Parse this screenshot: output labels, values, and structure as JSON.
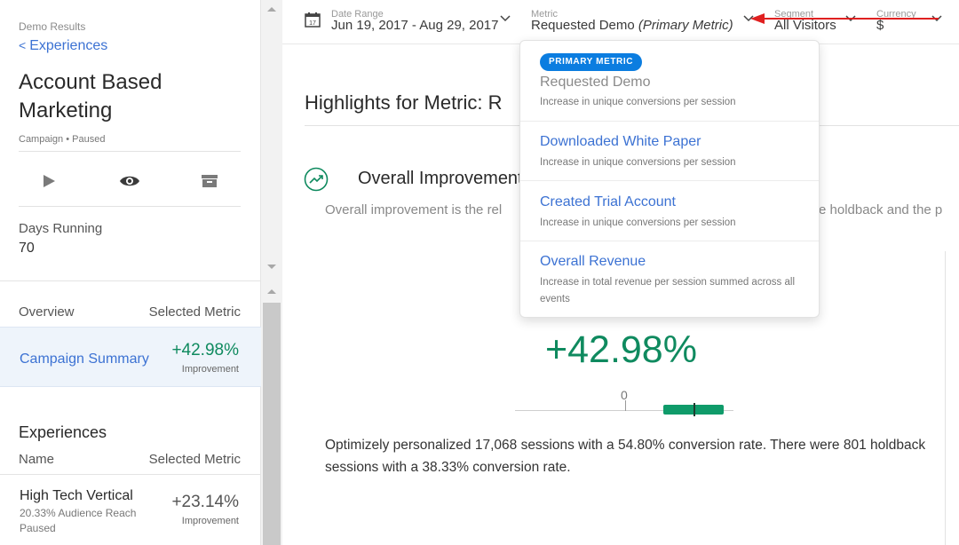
{
  "sidebar": {
    "breadcrumb_label": "Demo Results",
    "breadcrumb_link": "Experiences",
    "title": "Account Based Marketing",
    "meta_type": "Campaign",
    "meta_sep": "•",
    "meta_status": "Paused",
    "actions": [
      {
        "name": "play",
        "icon": "play-icon"
      },
      {
        "name": "preview",
        "icon": "eye-icon"
      },
      {
        "name": "archive",
        "icon": "archive-icon"
      }
    ],
    "days_running_label": "Days Running",
    "days_running_value": "70",
    "overview_label": "Overview",
    "selected_metric_label": "Selected Metric",
    "campaign_summary": {
      "label": "Campaign Summary",
      "value": "+42.98%",
      "sub": "Improvement"
    },
    "experiences_title": "Experiences",
    "name_label": "Name",
    "experiences": [
      {
        "name": "High Tech Vertical",
        "reach": "20.33% Audience Reach",
        "status": "Paused",
        "value": "+23.14%",
        "sub": "Improvement"
      }
    ]
  },
  "filters": {
    "date_range": {
      "caption": "Date Range",
      "value": "Jun 19, 2017 - Aug 29, 2017",
      "icon": "calendar-icon",
      "calendar_day": "17"
    },
    "metric": {
      "caption": "Metric",
      "value": "Requested Demo",
      "qualifier": "(Primary Metric)"
    },
    "segment": {
      "caption": "Segment",
      "value": "All Visitors"
    },
    "currency": {
      "caption": "Currency",
      "value": "$"
    }
  },
  "main": {
    "highlights_title": "Highlights for Metric: R",
    "overall_title": "Overall Improvement",
    "overall_desc_left": "Overall improvement is the rel",
    "overall_desc_right": "e holdback and the p",
    "improvement_value": "+42.98%",
    "axis_zero": "0",
    "summary": "Optimizely personalized 17,068 sessions with a 54.80% conversion rate. There were 801 holdback sessions with a 38.33% conversion rate."
  },
  "metric_dropdown": {
    "badge": "PRIMARY METRIC",
    "items": [
      {
        "title": "Requested Demo",
        "desc": "Increase in unique conversions per session"
      },
      {
        "title": "Downloaded White Paper",
        "desc": "Increase in unique conversions per session"
      },
      {
        "title": "Created Trial Account",
        "desc": "Increase in unique conversions per session"
      },
      {
        "title": "Overall Revenue",
        "desc": "Increase in total revenue per session summed across all events"
      }
    ]
  },
  "colors": {
    "link": "#3c72d3",
    "positive": "#0f8a5f",
    "badge": "#0b7de0",
    "annotation_arrow": "#e02020",
    "selected_row_bg": "#eef4fb"
  },
  "ci_bar": {
    "low_pct": 28,
    "estimate_pct": 42.98,
    "high_pct": 58
  }
}
